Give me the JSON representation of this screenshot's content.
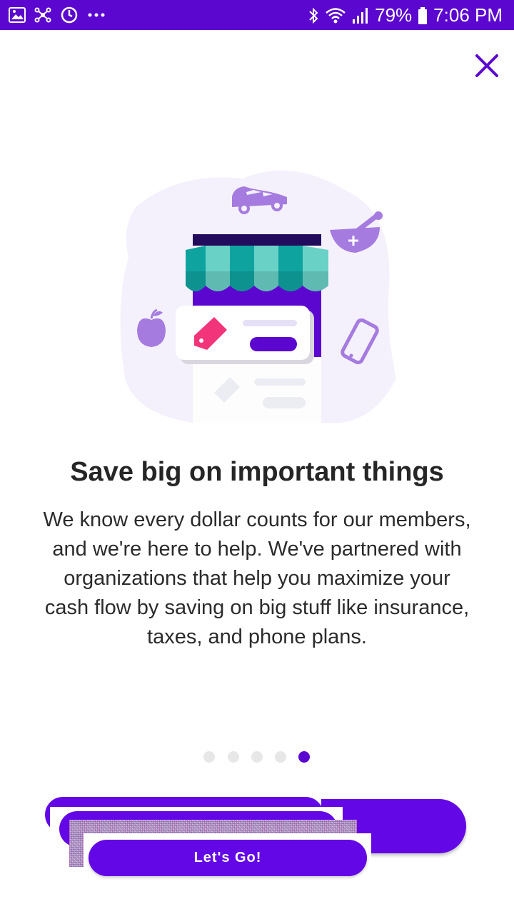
{
  "status_bar": {
    "battery": "79%",
    "time": "7:06 PM",
    "left_icons": [
      "gallery-icon",
      "network-icon",
      "sync-icon",
      "more-dots-icon"
    ],
    "right_icons": [
      "bluetooth-icon",
      "wifi-icon",
      "signal-icon",
      "battery-icon"
    ]
  },
  "onboarding": {
    "title": "Save big on important things",
    "description": "We know every dollar counts for our members, and we're here to help. We've partnered with organizations that help you maximize your cash flow by saving on big stuff like insurance, taxes, and phone plans.",
    "page_count": 5,
    "active_page": 5,
    "primary_button": "Let's Go!"
  },
  "colors": {
    "brand_purple": "#5b07cf",
    "button_purple": "#6307e6",
    "icon_purple": "#a57be0",
    "teal": "#0fa3a0",
    "pink": "#f2357a"
  }
}
